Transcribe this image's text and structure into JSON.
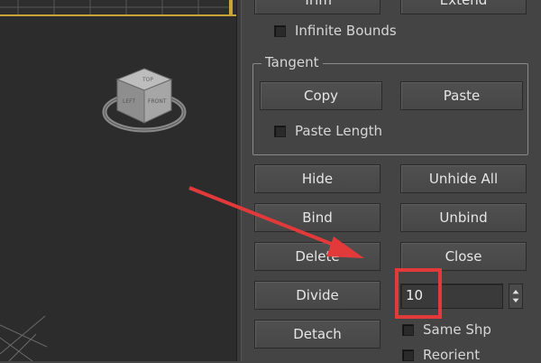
{
  "panel": {
    "top_buttons": [
      "Trim",
      "Extend"
    ],
    "infinite_bounds": "Infinite Bounds",
    "tangent_group": {
      "label": "Tangent",
      "copy": "Copy",
      "paste": "Paste",
      "paste_length": "Paste Length"
    },
    "buttons": {
      "hide": "Hide",
      "unhide_all": "Unhide All",
      "bind": "Bind",
      "unbind": "Unbind",
      "delete": "Delete",
      "close": "Close",
      "divide": "Divide",
      "detach": "Detach"
    },
    "divide_count": "10",
    "same_shp": "Same Shp",
    "reorient": "Reorient"
  },
  "viewcube": {
    "faces": [
      "TOP",
      "LEFT",
      "FRONT"
    ]
  },
  "colors": {
    "annotation": "#e23a3a",
    "viewport_border": "#c9a436"
  }
}
